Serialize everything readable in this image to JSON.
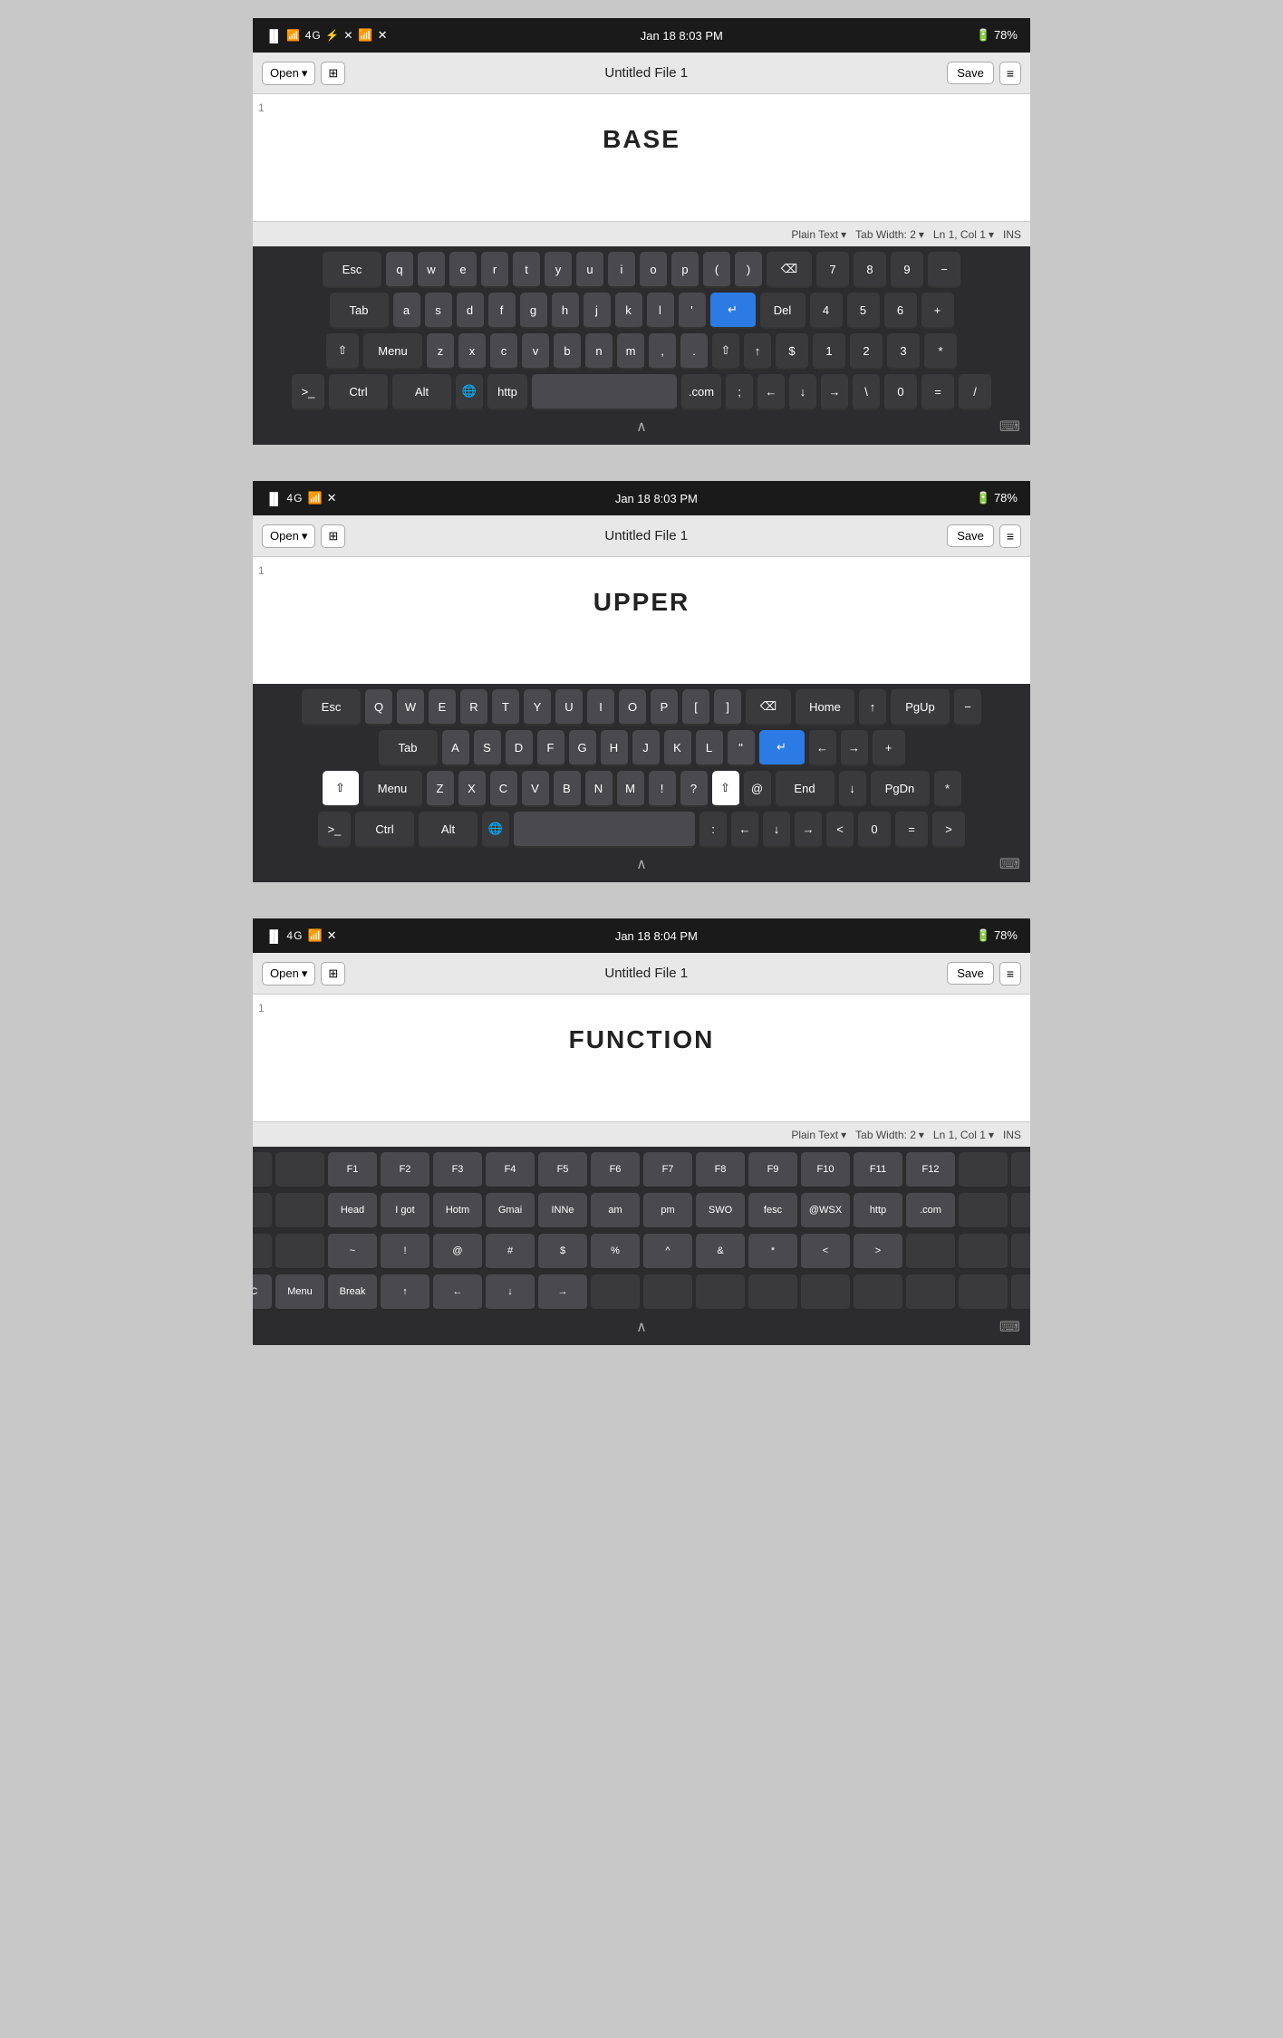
{
  "screens": [
    {
      "id": "base",
      "status": {
        "left": "📶 4G ⚡ ✕",
        "center": "Jan 18  8:03 PM",
        "right": "🔋 78%"
      },
      "toolbar": {
        "open": "Open",
        "title": "Untitled File 1",
        "save": "Save"
      },
      "editor": {
        "heading": "BASE"
      },
      "statusLine": {
        "mode": "Plain Text",
        "tabWidth": "Tab Width: 2",
        "position": "Ln 1, Col 1",
        "ins": "INS"
      },
      "keyboardLabel": "BASE"
    },
    {
      "id": "upper",
      "status": {
        "left": "📶 4G ⚡ ✕",
        "center": "Jan 18  8:03 PM",
        "right": "🔋 78%"
      },
      "toolbar": {
        "open": "Open",
        "title": "Untitled File 1",
        "save": "Save"
      },
      "editor": {
        "heading": "UPPER"
      },
      "statusLine": null,
      "keyboardLabel": "UPPER"
    },
    {
      "id": "function",
      "status": {
        "left": "📶 4G ⚡ ✕",
        "center": "Jan 18  8:04 PM",
        "right": "🔋 78%"
      },
      "toolbar": {
        "open": "Open",
        "title": "Untitled File 1",
        "save": "Save"
      },
      "editor": {
        "heading": "FUNCTION"
      },
      "statusLine": {
        "mode": "Plain Text",
        "tabWidth": "Tab Width: 2",
        "position": "Ln 1, Col 1",
        "ins": "INS"
      },
      "keyboardLabel": "FUNCTION"
    }
  ]
}
